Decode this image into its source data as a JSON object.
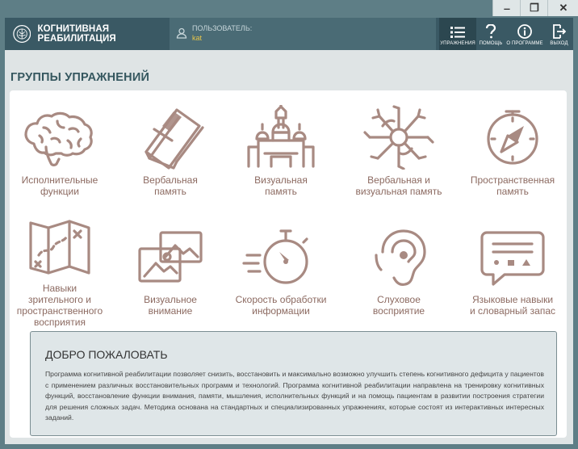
{
  "window": {
    "minimize": "‒",
    "maximize": "❐",
    "close": "✕"
  },
  "header": {
    "app_title": "КОГНИТИВНАЯ РЕАБИЛИТАЦИЯ",
    "user_label": "ПОЛЬЗОВАТЕЛЬ:",
    "user_name": "kat",
    "nav": [
      {
        "label": "УПРАЖНЕНИЯ",
        "icon": "list-icon"
      },
      {
        "label": "ПОМОЩЬ",
        "icon": "question-icon"
      },
      {
        "label": "О ПРОГРАММЕ",
        "icon": "info-icon"
      },
      {
        "label": "ВЫХОД",
        "icon": "exit-icon"
      }
    ]
  },
  "page": {
    "title": "ГРУППЫ УПРАЖНЕНИЙ"
  },
  "groups": [
    {
      "line1": "Исполнительные",
      "line2": "функции",
      "icon": "brain-icon"
    },
    {
      "line1": "Вербальная",
      "line2": "память",
      "icon": "book-icon"
    },
    {
      "line1": "Визуальная",
      "line2": "память",
      "icon": "kremlin-icon"
    },
    {
      "line1": "Вербальная и",
      "line2": "визуальная память",
      "icon": "neuron-icon"
    },
    {
      "line1": "Пространственная",
      "line2": "память",
      "icon": "compass-icon"
    },
    {
      "line1": "Навыки",
      "line2": "зрительного и",
      "line3": "пространственного",
      "line4": "восприятия",
      "icon": "map-icon"
    },
    {
      "line1": "Визуальное",
      "line2": "внимание",
      "icon": "images-icon"
    },
    {
      "line1": "Скорость обработки",
      "line2": "информации",
      "icon": "stopwatch-icon"
    },
    {
      "line1": "Слуховое",
      "line2": "восприятие",
      "icon": "ear-icon"
    },
    {
      "line1": "Языковые навыки",
      "line2": "и словарный запас",
      "icon": "speech-bubble-icon"
    }
  ],
  "welcome": {
    "title": "ДОБРО ПОЖАЛОВАТЬ",
    "text": "Программа когнитивной реабилитации позволяет снизить, восстановить и максимально возможно улучшить степень когнитивного дефицита у пациентов с применением различных восстановительных программ и технологий. Программа когнитивной реабилитации направлена на тренировку когнитивных функций, восстановление функции внимания, памяти, мышления, исполнительных функций и на помощь пациентам в развитии построения стратегии для решения сложных задач. Методика основана на стандартных и специализированных упражнениях, которые состоят из интерактивных интересных заданий."
  }
}
